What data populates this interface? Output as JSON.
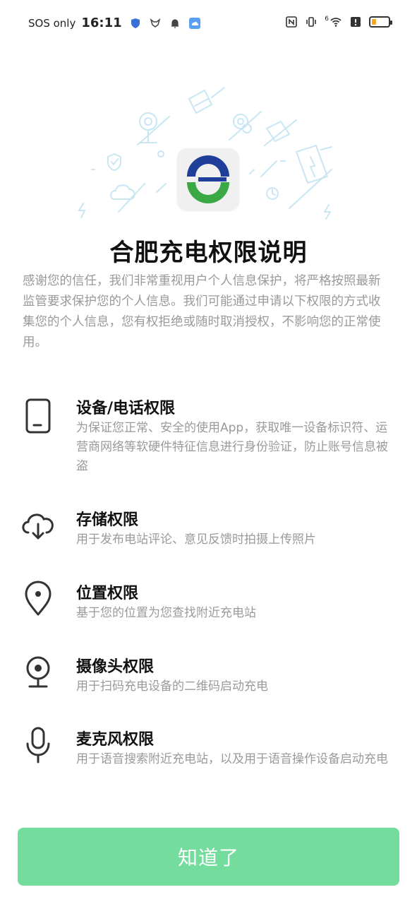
{
  "status_bar": {
    "carrier": "SOS only",
    "time": "16:11",
    "network_badge": "6"
  },
  "dialog": {
    "title": "合肥充电权限说明",
    "intro": "感谢您的信任，我们非常重视用户个人信息保护，将严格按照最新监管要求保护您的个人信息。我们可能通过申请以下权限的方式收集您的个人信息，您有权拒绝或随时取消授权，不影响您的正常使用。",
    "permissions": [
      {
        "icon": "phone-device-icon",
        "title": "设备/电话权限",
        "desc": "为保证您正常、安全的使用App，获取唯一设备标识符、运营商网络等软硬件特征信息进行身份验证，防止账号信息被盗"
      },
      {
        "icon": "cloud-download-icon",
        "title": "存储权限",
        "desc": "用于发布电站评论、意见反馈时拍摄上传照片"
      },
      {
        "icon": "location-pin-icon",
        "title": "位置权限",
        "desc": "基于您的位置为您查找附近充电站"
      },
      {
        "icon": "camera-icon",
        "title": "摄像头权限",
        "desc": "用于扫码充电设备的二维码启动充电"
      },
      {
        "icon": "microphone-icon",
        "title": "麦克风权限",
        "desc": "用于语音搜索附近充电站，以及用于语音操作设备启动充电"
      }
    ],
    "confirm_label": "知道了"
  },
  "colors": {
    "button_bg": "#74dc9c",
    "logo_blue": "#1f3f9a",
    "logo_green": "#3aa845",
    "illustration": "#c9e6f3"
  }
}
